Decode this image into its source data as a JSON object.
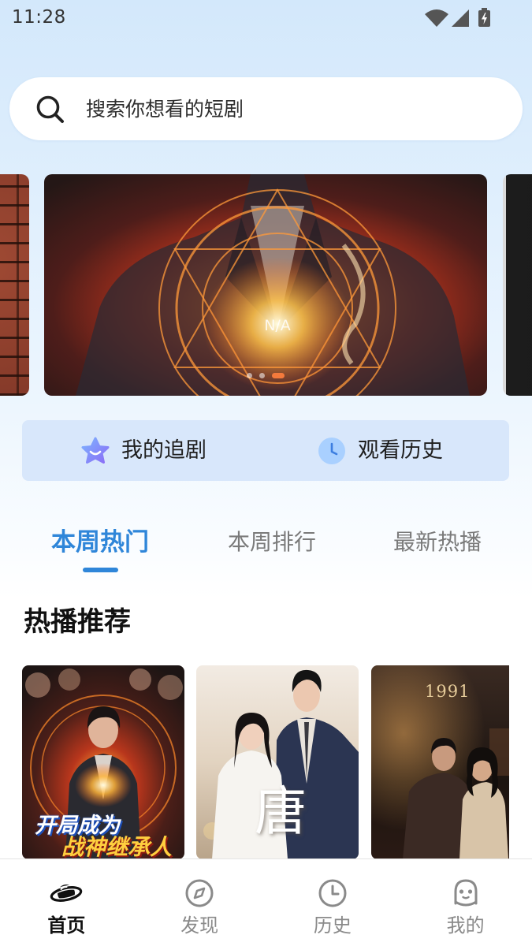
{
  "status_bar": {
    "time": "11:28",
    "icons": [
      "wifi-icon",
      "signal-icon",
      "battery-charging-icon"
    ]
  },
  "search": {
    "placeholder": "搜索你想看的短剧",
    "value": "",
    "icon": "search-icon"
  },
  "banner": {
    "caption": "N/A",
    "indicator": {
      "count": 3,
      "active_index": 2
    }
  },
  "quick_actions": [
    {
      "label": "我的追剧",
      "icon": "star-icon"
    },
    {
      "label": "观看历史",
      "icon": "clock-icon"
    }
  ],
  "tabs": [
    {
      "label": "本周热门",
      "active": true
    },
    {
      "label": "本周排行",
      "active": false
    },
    {
      "label": "最新热播",
      "active": false
    }
  ],
  "section": {
    "title": "热播推荐"
  },
  "posters": [
    {
      "art_text": [
        "开局成为",
        "战神继承人"
      ]
    },
    {
      "art_text": [
        "唐"
      ]
    },
    {
      "art_text": [
        "1991"
      ]
    }
  ],
  "bottom_nav": [
    {
      "label": "首页",
      "icon": "planet-icon",
      "active": true
    },
    {
      "label": "发现",
      "icon": "compass-icon",
      "active": false
    },
    {
      "label": "历史",
      "icon": "clock-icon",
      "active": false
    },
    {
      "label": "我的",
      "icon": "robot-icon",
      "active": false
    }
  ],
  "theme": {
    "accent": "#2f86d9",
    "indicator_active": "#f47a3c",
    "nav_active": "#111111",
    "nav_inactive": "#8a8a8a",
    "panel_bg": "#d8e7fb"
  }
}
